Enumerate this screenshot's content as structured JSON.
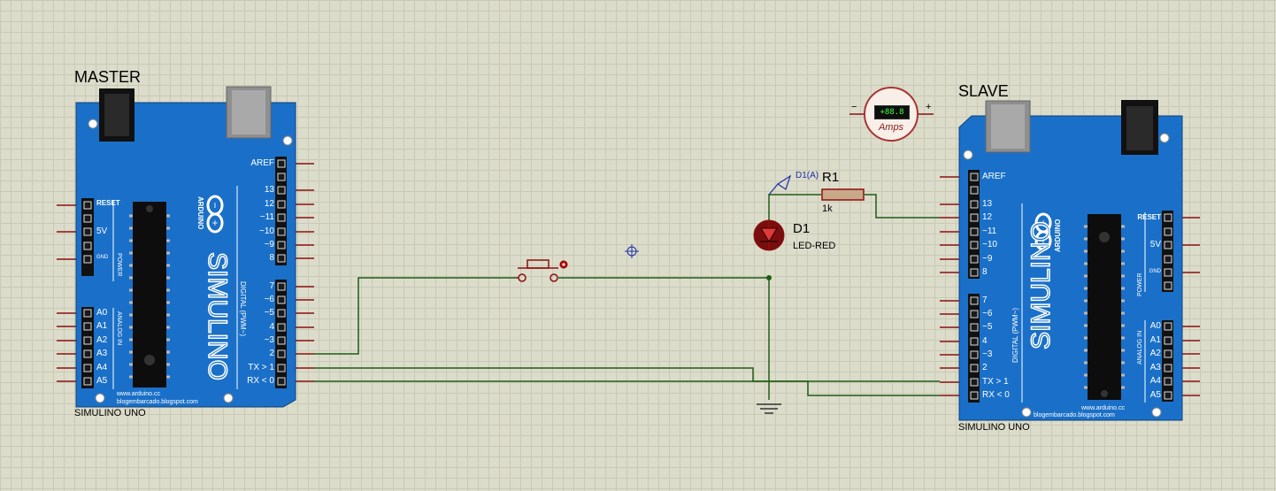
{
  "master": {
    "title": "MASTER",
    "model": "SIMULINO UNO",
    "brand": "SIMULINO",
    "arduino": "ARDUINO",
    "url1": "www.arduino.cc",
    "url2": "blogembarcado.blogspot.com",
    "power_pins": [
      "RESET",
      "5V",
      "GND"
    ],
    "analog_pins": [
      "A0",
      "A1",
      "A2",
      "A3",
      "A4",
      "A5"
    ],
    "digital_high": [
      "AREF",
      "13",
      "12",
      "~11",
      "~10",
      "~9",
      "8"
    ],
    "digital_low": [
      "7",
      "~6",
      "~5",
      "4",
      "~3",
      "2",
      "TX > 1",
      "RX < 0"
    ],
    "power_label": "POWER",
    "analog_label": "ANALOG IN",
    "digital_label": "DIGITAL (PWM~)"
  },
  "slave": {
    "title": "SLAVE",
    "model": "SIMULINO UNO",
    "brand": "SIMULINO",
    "arduino": "ARDUINO",
    "url1": "www.arduino.cc",
    "url2": "blogembarcado.blogspot.com",
    "power_pins": [
      "RESET",
      "5V",
      "GND"
    ],
    "analog_pins": [
      "A0",
      "A1",
      "A2",
      "A3",
      "A4",
      "A5"
    ],
    "digital_high": [
      "AREF",
      "13",
      "12",
      "~11",
      "~10",
      "~9",
      "8"
    ],
    "digital_low": [
      "7",
      "~6",
      "~5",
      "4",
      "~3",
      "2",
      "TX > 1",
      "RX < 0"
    ],
    "power_label": "POWER",
    "analog_label": "ANALOG IN",
    "digital_label": "DIGITAL (PWM~)"
  },
  "components": {
    "resistor_ref": "R1",
    "resistor_value": "1k",
    "led_ref": "D1",
    "led_value": "LED-RED",
    "probe_label": "D1(A)",
    "ammeter_display": "+88.8",
    "ammeter_unit": "Amps",
    "ammeter_minus": "−",
    "ammeter_plus": "+"
  },
  "colors": {
    "board": "#1a70c8",
    "wire": "#1e5c14",
    "pin_red": "#8a1010",
    "background": "#dcdccb"
  }
}
